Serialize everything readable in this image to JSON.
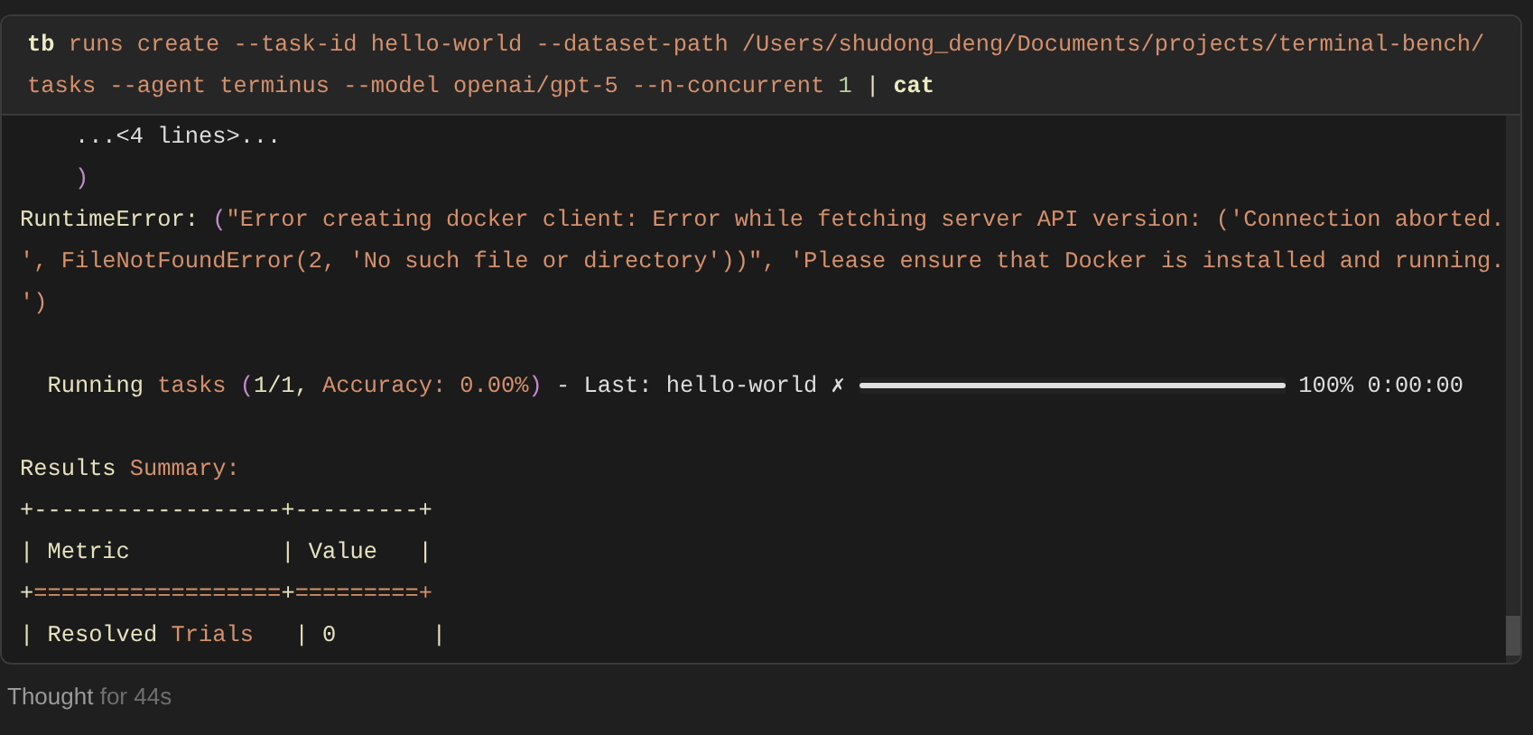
{
  "command": {
    "lines": [
      [
        {
          "text": "tb",
          "kind": "bold"
        },
        {
          "text": " runs create --task-id hello-world --dataset-path /Users/shudong_deng/Documents/projects/terminal-bench/",
          "kind": "string"
        }
      ],
      [
        {
          "text": "tasks --agent terminus --model openai/gpt-5 --n-concurrent ",
          "kind": "string"
        },
        {
          "text": "1",
          "kind": "number"
        },
        {
          "text": " | ",
          "kind": "plain"
        },
        {
          "text": "cat",
          "kind": "bold"
        }
      ]
    ]
  },
  "output": {
    "lines": [
      [
        {
          "text": "    ...<4 lines>...",
          "kind": "white"
        }
      ],
      [
        {
          "text": "    )",
          "kind": "punct"
        }
      ],
      [
        {
          "text": "RuntimeError: ",
          "kind": "plain"
        },
        {
          "text": "(",
          "kind": "punct"
        },
        {
          "text": "\"Error creating docker client: Error while fetching server API version: ('Connection aborted.",
          "kind": "string"
        }
      ],
      [
        {
          "text": "', FileNotFoundError(2, 'No such file or directory'))\", 'Please ensure that Docker is installed and running.",
          "kind": "string"
        }
      ],
      [
        {
          "text": "')",
          "kind": "string"
        }
      ],
      {
        "kind": "blank"
      },
      [
        {
          "text": "  Running ",
          "kind": "plain"
        },
        {
          "text": "tasks ",
          "kind": "string"
        },
        {
          "text": "(",
          "kind": "punct"
        },
        {
          "text": "1/1, ",
          "kind": "plain"
        },
        {
          "text": "Accuracy: 0.00%",
          "kind": "string"
        },
        {
          "text": ")",
          "kind": "punct"
        },
        {
          "text": " - Last: hello-world ✗ ",
          "kind": "white"
        },
        {
          "kind": "bar",
          "level": 1
        },
        {
          "text": " 100% 0:00:00",
          "kind": "white"
        }
      ],
      {
        "kind": "blank"
      },
      [
        {
          "text": "Results ",
          "kind": "plain"
        },
        {
          "text": "Summary:",
          "kind": "string"
        }
      ],
      [
        {
          "text": "+------------------+---------+",
          "kind": "plain"
        }
      ],
      [
        {
          "text": "| Metric           | Value   |",
          "kind": "plain"
        }
      ],
      [
        {
          "text": "+",
          "kind": "plain"
        },
        {
          "text": "==================",
          "kind": "string"
        },
        {
          "text": "+",
          "kind": "plain"
        },
        {
          "text": "=========",
          "kind": "string"
        },
        {
          "text": "+",
          "kind": "string"
        }
      ],
      [
        {
          "text": "| Resolved ",
          "kind": "plain"
        },
        {
          "text": "Trials",
          "kind": "string"
        },
        {
          "text": "   | 0       |",
          "kind": "plain"
        }
      ]
    ]
  },
  "footer": {
    "label": "Thought",
    "detail": "for 44s"
  }
}
